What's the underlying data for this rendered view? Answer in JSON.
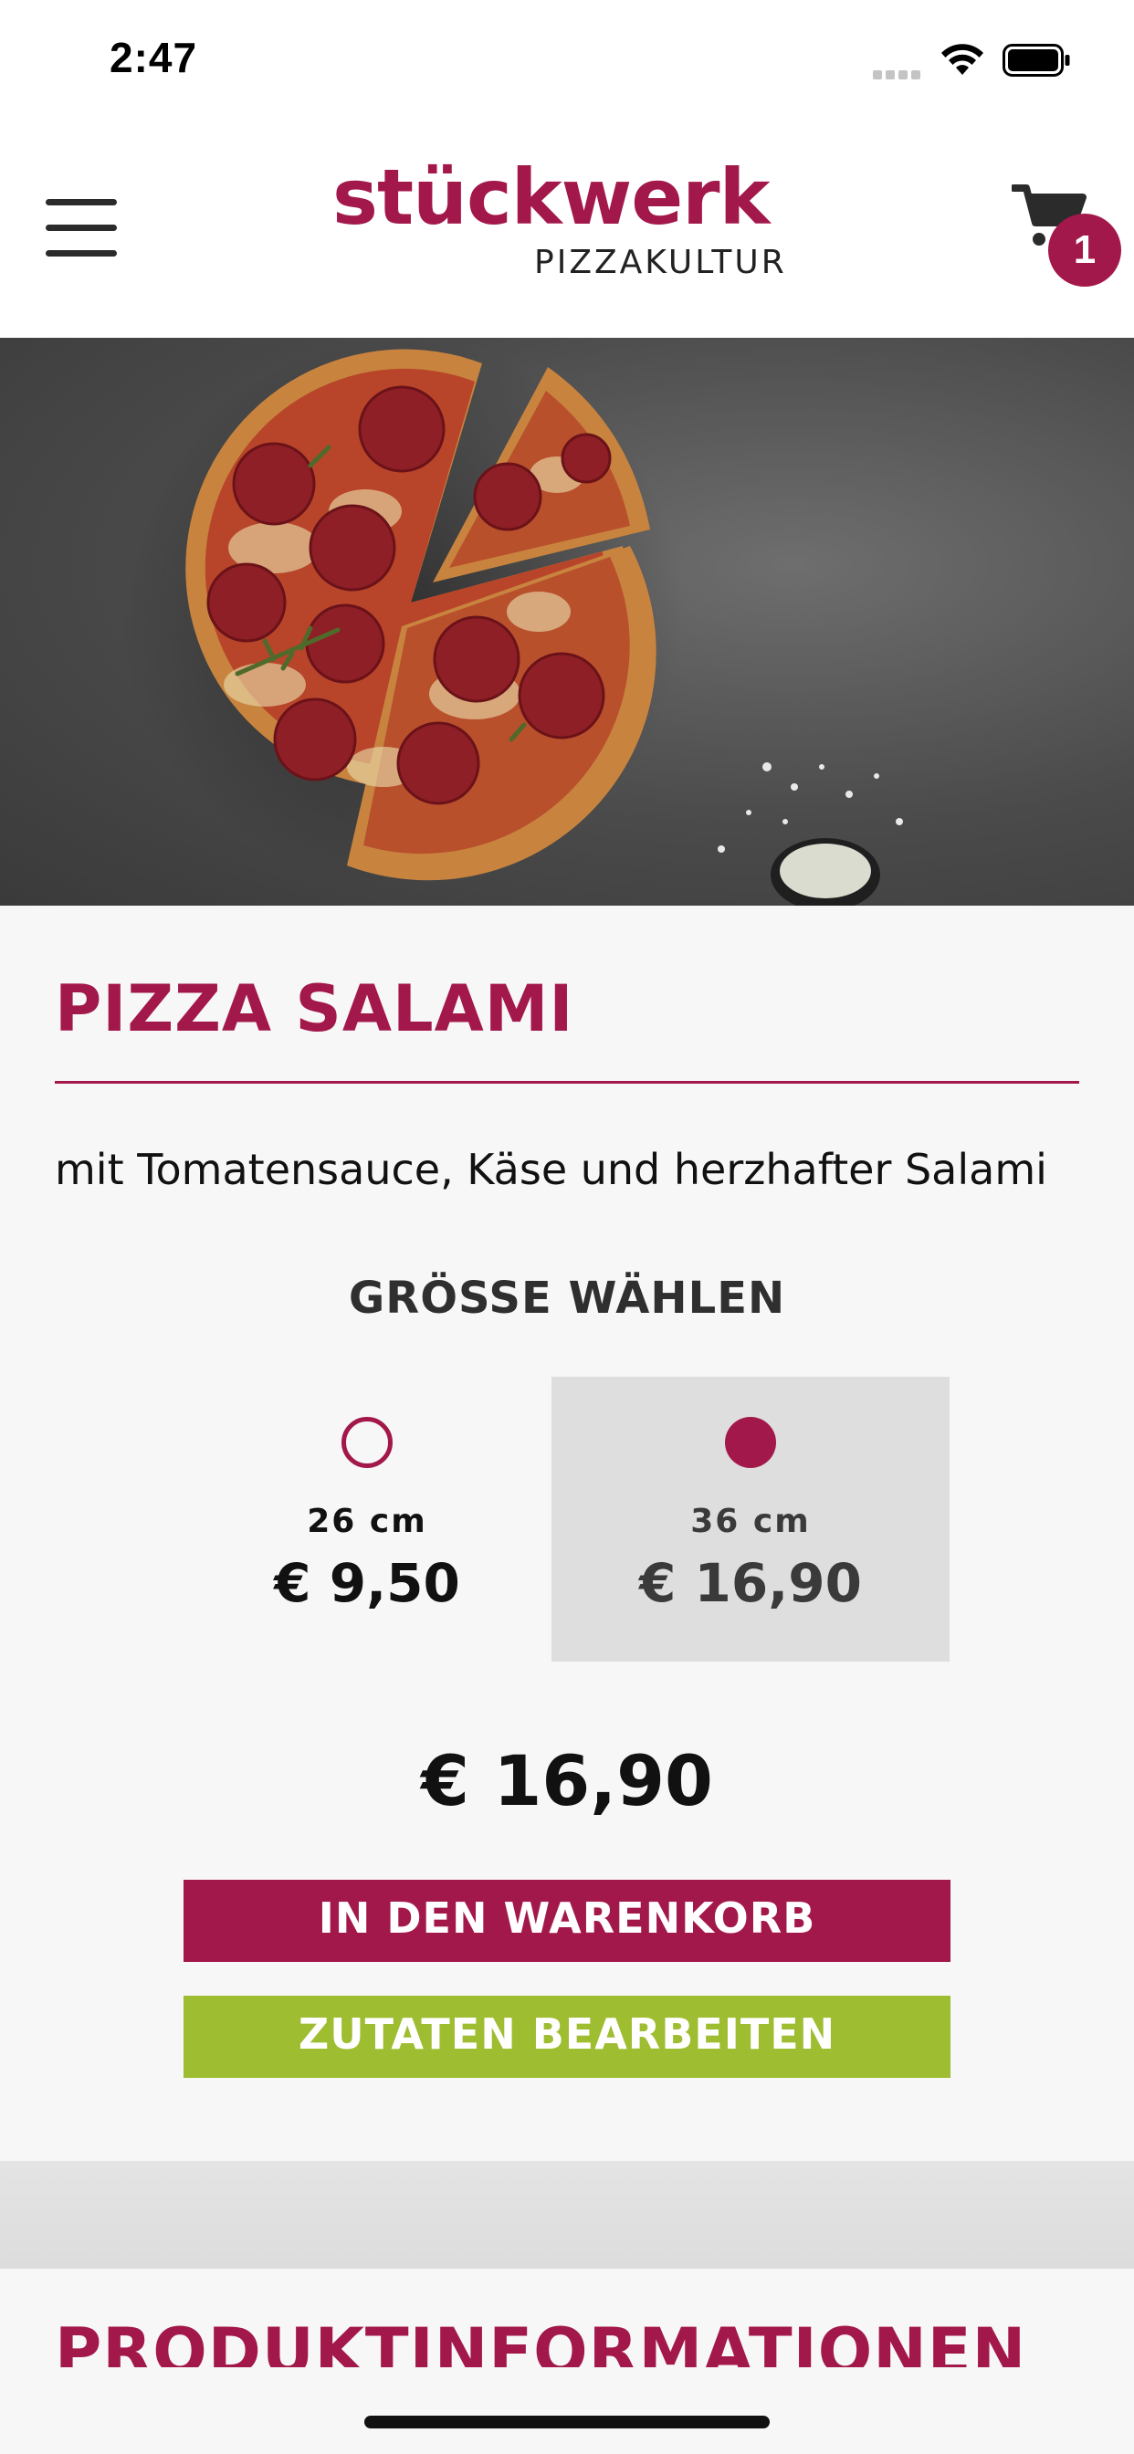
{
  "status_bar": {
    "time": "2:47"
  },
  "header": {
    "logo_main": "stückwerk",
    "logo_sub": "PIZZAKULTUR",
    "cart_count": "1"
  },
  "product": {
    "title": "PIZZA SALAMI",
    "description": "mit Tomatensauce, Käse und herzhafter Salami",
    "size_heading": "GRÖSSE WÄHLEN",
    "sizes": [
      {
        "label": "26 cm",
        "price": "€ 9,50",
        "selected": false
      },
      {
        "label": "36 cm",
        "price": "€ 16,90",
        "selected": true
      }
    ],
    "total_price": "€ 16,90",
    "add_to_cart_label": "IN DEN WARENKORB",
    "edit_ingredients_label": "ZUTATEN BEARBEITEN"
  },
  "info": {
    "heading": "PRODUKTINFORMATIONEN"
  },
  "colors": {
    "brand": "#a3184a",
    "accent_green": "#9fbd30",
    "selected_bg": "#dedede"
  },
  "icons": [
    "hamburger-menu-icon",
    "cart-icon",
    "wifi-icon",
    "battery-icon",
    "signal-icon"
  ]
}
